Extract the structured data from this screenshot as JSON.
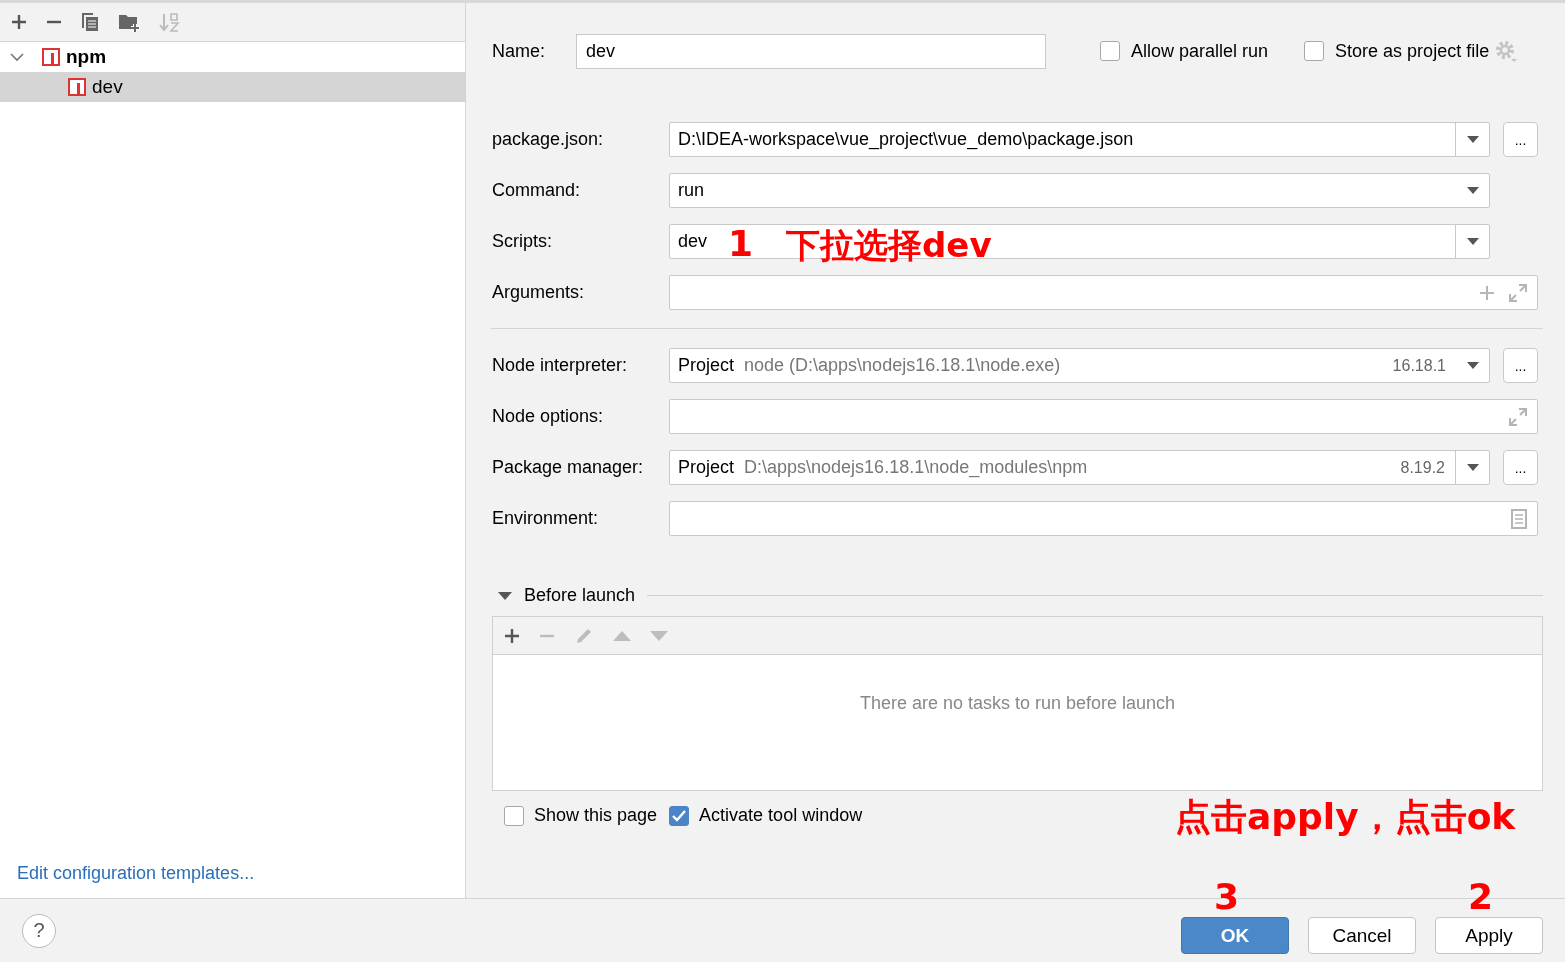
{
  "tree": [
    {
      "label": "npm",
      "expanded": true,
      "selected": false,
      "children": [
        {
          "label": "dev",
          "selected": true
        }
      ]
    }
  ],
  "templates_link": "Edit configuration templates...",
  "name": {
    "label": "Name:",
    "value": "dev"
  },
  "options": [
    {
      "label": "Allow parallel run",
      "checked": false
    },
    {
      "label": "Store as project file",
      "checked": false
    }
  ],
  "field_groups": [
    [
      {
        "kind": "combo",
        "label": "package.json:",
        "value": "D:\\IDEA-workspace\\vue_project\\vue_demo\\package.json",
        "browse": "..."
      },
      {
        "kind": "select",
        "label": "Command:",
        "value": "run"
      },
      {
        "kind": "combo",
        "label": "Scripts:",
        "value": "dev",
        "notes": [
          "1",
          "下拉选择dev"
        ]
      },
      {
        "kind": "args",
        "label": "Arguments:"
      }
    ],
    [
      {
        "kind": "select",
        "label": "Node interpreter:",
        "prefix": "Project",
        "value": "node (D:\\apps\\nodejs16.18.1\\node.exe)",
        "version": "16.18.1",
        "browse": "..."
      },
      {
        "kind": "text",
        "label": "Node options:"
      },
      {
        "kind": "combo",
        "label": "Package manager:",
        "prefix": "Project",
        "value": "D:\\apps\\nodejs16.18.1\\node_modules\\npm",
        "version": "8.19.2",
        "browse": "..."
      },
      {
        "kind": "env",
        "label": "Environment:"
      }
    ]
  ],
  "before_launch": {
    "title": "Before launch",
    "expanded": true,
    "tools": [
      {
        "kind": "add",
        "disabled": false
      },
      {
        "kind": "remove",
        "disabled": true
      },
      {
        "kind": "edit",
        "disabled": true
      },
      {
        "kind": "up",
        "disabled": true
      },
      {
        "kind": "down",
        "disabled": true
      }
    ],
    "empty_text": "There are no tasks to run before launch"
  },
  "launch_options": [
    {
      "label": "Show this page",
      "checked": false
    },
    {
      "label": "Activate tool window",
      "checked": true
    }
  ],
  "footer_note": "点击apply，点击ok",
  "help": "?",
  "buttons": [
    {
      "label": "OK",
      "kind": "primary",
      "note": "3"
    },
    {
      "label": "Cancel",
      "kind": "default"
    },
    {
      "label": "Apply",
      "kind": "default",
      "note": "2"
    }
  ]
}
